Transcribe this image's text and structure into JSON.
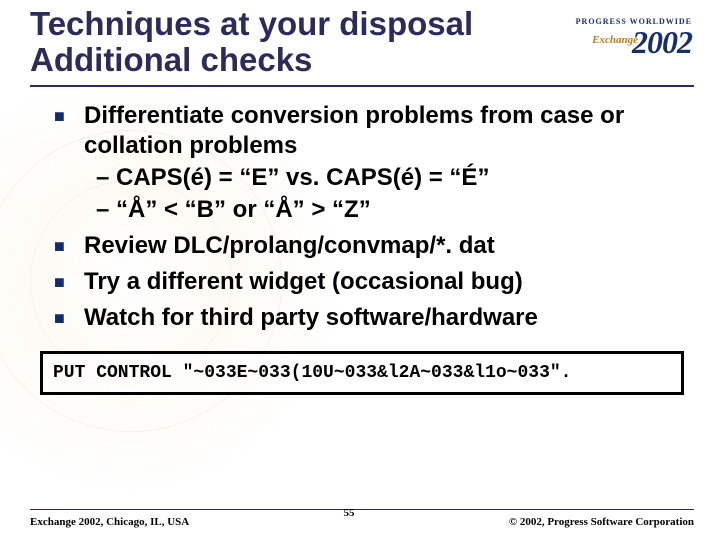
{
  "logo": {
    "tagline": "PROGRESS WORLDWIDE",
    "brand": "Exchange",
    "year": "2002"
  },
  "title": "Techniques at your disposal Additional checks",
  "bullets": [
    {
      "text": "Differentiate conversion problems from case or collation problems",
      "sub": [
        "CAPS(é) = “E” vs. CAPS(é) = “É”",
        "“Å”  < “B”  or “Å”  > “Z”"
      ]
    },
    {
      "text": "Review DLC/prolang/convmap/*. dat"
    },
    {
      "text": "Try a different widget (occasional bug)"
    },
    {
      "text": "Watch for third party software/hardware"
    }
  ],
  "code": "PUT CONTROL \"~033E~033(10U~033&l2A~033&l1o~033\".",
  "footer": {
    "left": "Exchange 2002, Chicago, IL, USA",
    "page": "55",
    "right": "© 2002, Progress Software Corporation"
  }
}
